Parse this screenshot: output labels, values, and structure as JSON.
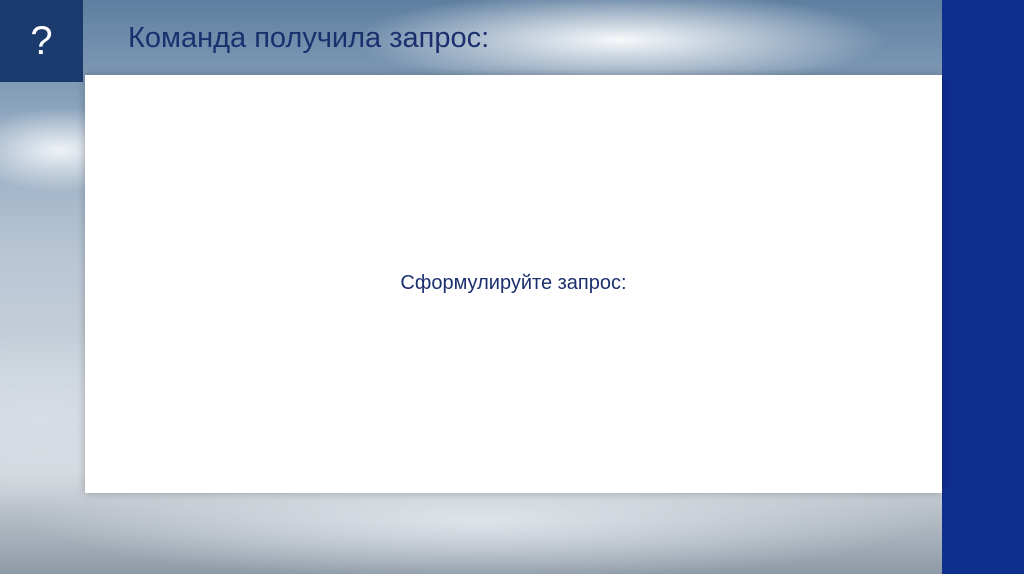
{
  "slide": {
    "question_mark": "?",
    "title": "Команда получила запрос:",
    "prompt": "Сформулируйте запрос:"
  },
  "colors": {
    "accent_dark": "#1b3a6e",
    "right_band": "#0f2f8f",
    "text": "#1b2f6e"
  }
}
